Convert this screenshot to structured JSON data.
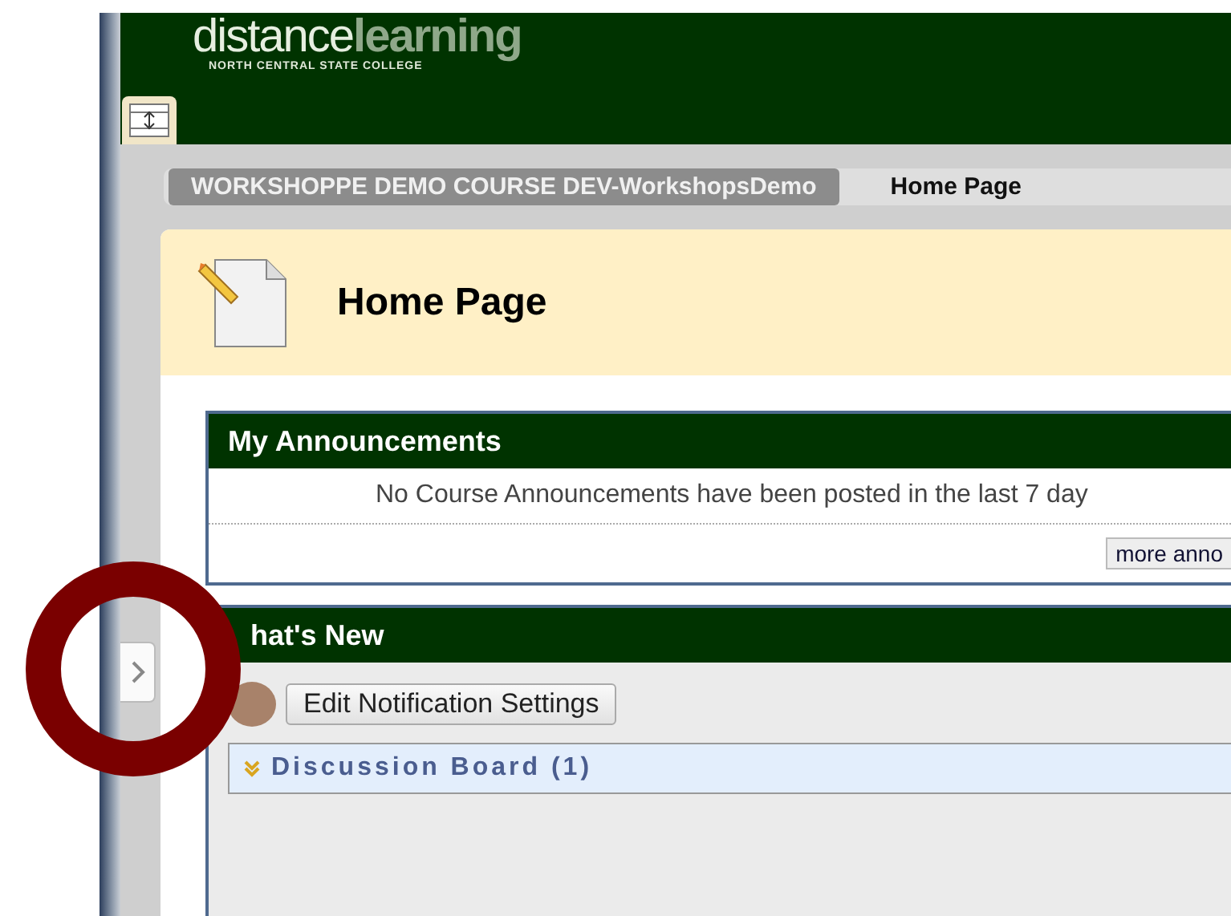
{
  "header": {
    "logo": {
      "word_1": "distance",
      "word_2": "learning",
      "subtitle": "NORTH CENTRAL STATE COLLEGE"
    }
  },
  "breadcrumbs": [
    {
      "label": "WORKSHOPPE DEMO COURSE DEV-WorkshopsDemo",
      "selected": false
    },
    {
      "label": "Home Page",
      "selected": true
    }
  ],
  "page_title": "Home Page",
  "modules": [
    {
      "kind": "announcements",
      "title": "My Announcements",
      "message": "No Course Announcements have been posted in the last 7 day",
      "button": "more anno"
    },
    {
      "kind": "whats_new",
      "title": "hat's New",
      "button": "Edit Notification Settings",
      "items": [
        {
          "label": "Discussion Board (1)",
          "expanded": false
        }
      ]
    }
  ]
}
